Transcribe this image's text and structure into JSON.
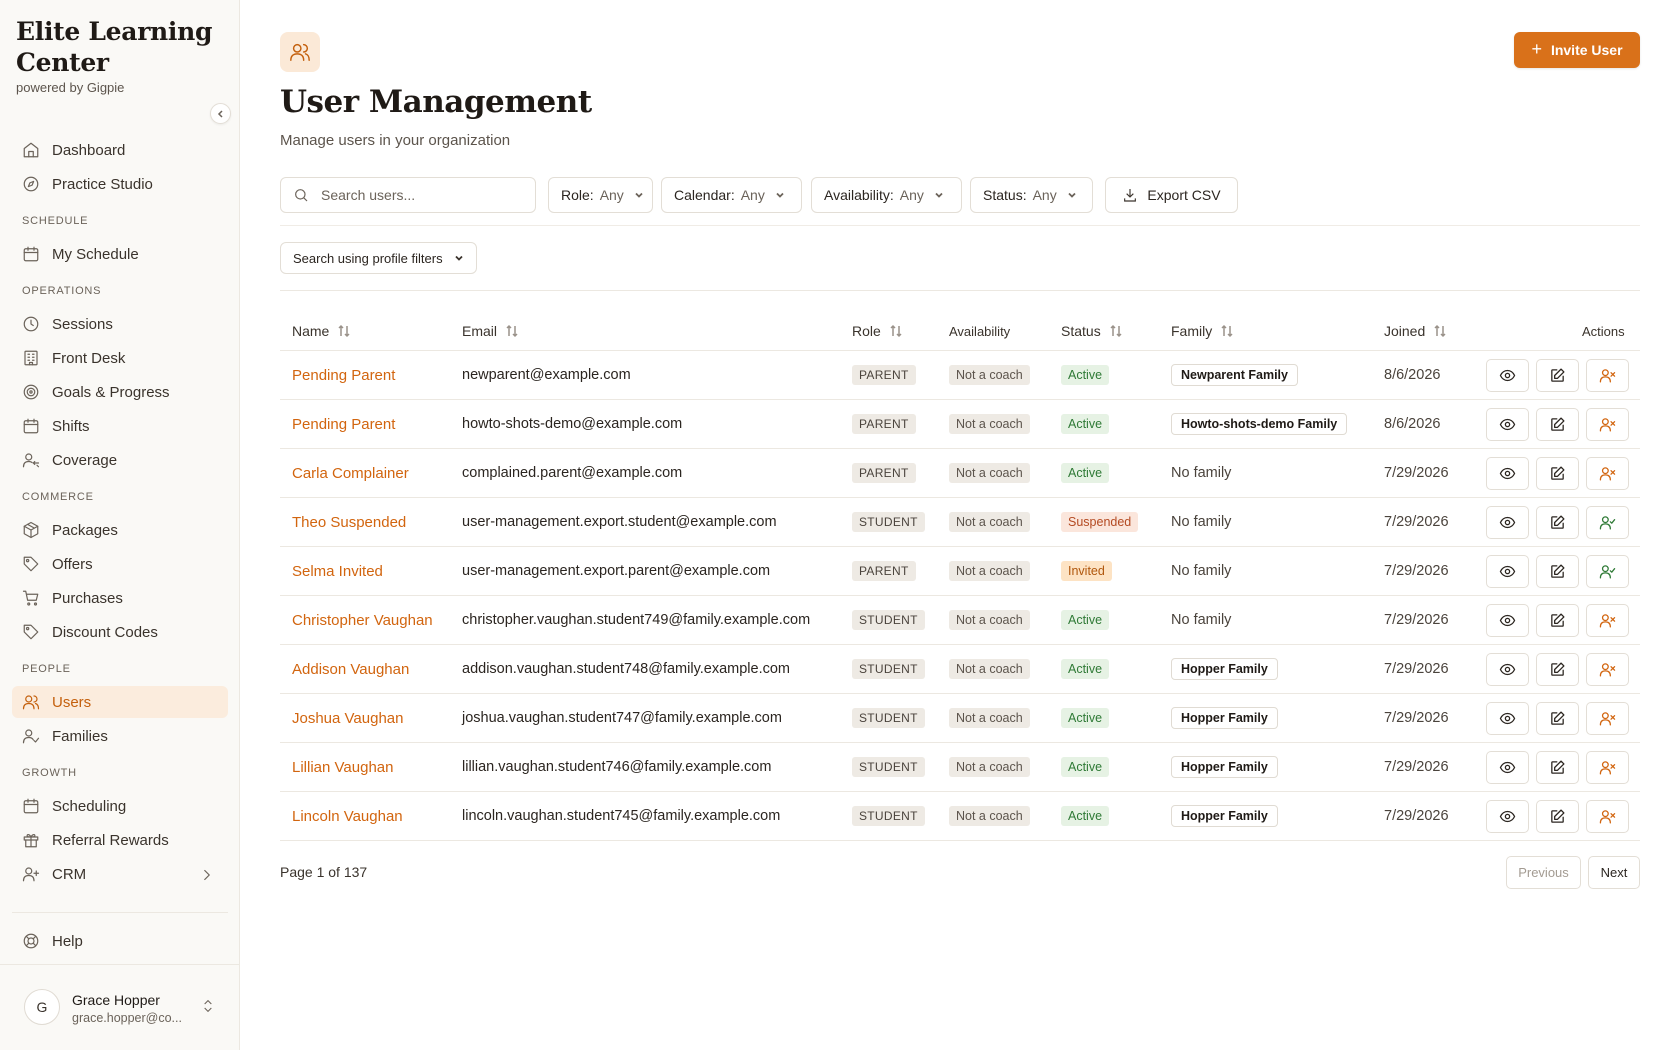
{
  "brand": {
    "title": "Elite Learning Center",
    "subtitle": "powered by Gigpie"
  },
  "sidebar": {
    "top_items": [
      {
        "label": "Dashboard",
        "icon": "home-icon"
      },
      {
        "label": "Practice Studio",
        "icon": "compass-icon"
      }
    ],
    "sections": [
      {
        "title": "SCHEDULE",
        "items": [
          {
            "label": "My Schedule",
            "icon": "calendar-icon"
          }
        ]
      },
      {
        "title": "OPERATIONS",
        "items": [
          {
            "label": "Sessions",
            "icon": "clock-icon"
          },
          {
            "label": "Front Desk",
            "icon": "building-icon"
          },
          {
            "label": "Goals & Progress",
            "icon": "target-icon"
          },
          {
            "label": "Shifts",
            "icon": "calendar-icon"
          },
          {
            "label": "Coverage",
            "icon": "user-swap-icon"
          }
        ]
      },
      {
        "title": "COMMERCE",
        "items": [
          {
            "label": "Packages",
            "icon": "package-icon"
          },
          {
            "label": "Offers",
            "icon": "tag-icon"
          },
          {
            "label": "Purchases",
            "icon": "cart-icon"
          },
          {
            "label": "Discount Codes",
            "icon": "tag-icon"
          }
        ]
      },
      {
        "title": "PEOPLE",
        "items": [
          {
            "label": "Users",
            "icon": "users-icon",
            "active": true
          },
          {
            "label": "Families",
            "icon": "user-check-icon"
          }
        ]
      },
      {
        "title": "GROWTH",
        "items": [
          {
            "label": "Scheduling",
            "icon": "calendar-icon"
          },
          {
            "label": "Referral Rewards",
            "icon": "gift-icon"
          },
          {
            "label": "CRM",
            "icon": "user-plus-icon",
            "has_chevron": true
          }
        ]
      }
    ],
    "help_label": "Help",
    "user": {
      "initial": "G",
      "name": "Grace Hopper",
      "email": "grace.hopper@co..."
    }
  },
  "header": {
    "title": "User Management",
    "subtitle": "Manage users in your organization",
    "invite_label": "Invite User"
  },
  "filters": {
    "search_placeholder": "Search users...",
    "role": {
      "label": "Role:",
      "value": "Any"
    },
    "calendar": {
      "label": "Calendar:",
      "value": "Any"
    },
    "availability": {
      "label": "Availability:",
      "value": "Any"
    },
    "status": {
      "label": "Status:",
      "value": "Any"
    },
    "export_label": "Export CSV",
    "profile_filter_label": "Search using profile filters"
  },
  "table": {
    "columns": {
      "name": "Name",
      "email": "Email",
      "role": "Role",
      "availability": "Availability",
      "status": "Status",
      "family": "Family",
      "joined": "Joined",
      "actions": "Actions"
    },
    "rows": [
      {
        "name": "Pending Parent",
        "email": "newparent@example.com",
        "role": "PARENT",
        "availability": "Not a coach",
        "status": "Active",
        "family": "Newparent Family",
        "joined": "8/6/2026",
        "account_action": "deactivate"
      },
      {
        "name": "Pending Parent",
        "email": "howto-shots-demo@example.com",
        "role": "PARENT",
        "availability": "Not a coach",
        "status": "Active",
        "family": "Howto-shots-demo Family",
        "joined": "8/6/2026",
        "account_action": "deactivate"
      },
      {
        "name": "Carla Complainer",
        "email": "complained.parent@example.com",
        "role": "PARENT",
        "availability": "Not a coach",
        "status": "Active",
        "family": "No family",
        "joined": "7/29/2026",
        "account_action": "deactivate"
      },
      {
        "name": "Theo Suspended",
        "email": "user-management.export.student@example.com",
        "role": "STUDENT",
        "availability": "Not a coach",
        "status": "Suspended",
        "family": "No family",
        "joined": "7/29/2026",
        "account_action": "reactivate"
      },
      {
        "name": "Selma Invited",
        "email": "user-management.export.parent@example.com",
        "role": "PARENT",
        "availability": "Not a coach",
        "status": "Invited",
        "family": "No family",
        "joined": "7/29/2026",
        "account_action": "reactivate"
      },
      {
        "name": "Christopher Vaughan",
        "email": "christopher.vaughan.student749@family.example.com",
        "role": "STUDENT",
        "availability": "Not a coach",
        "status": "Active",
        "family": "No family",
        "joined": "7/29/2026",
        "account_action": "deactivate"
      },
      {
        "name": "Addison Vaughan",
        "email": "addison.vaughan.student748@family.example.com",
        "role": "STUDENT",
        "availability": "Not a coach",
        "status": "Active",
        "family": "Hopper Family",
        "joined": "7/29/2026",
        "account_action": "deactivate"
      },
      {
        "name": "Joshua Vaughan",
        "email": "joshua.vaughan.student747@family.example.com",
        "role": "STUDENT",
        "availability": "Not a coach",
        "status": "Active",
        "family": "Hopper Family",
        "joined": "7/29/2026",
        "account_action": "deactivate"
      },
      {
        "name": "Lillian Vaughan",
        "email": "lillian.vaughan.student746@family.example.com",
        "role": "STUDENT",
        "availability": "Not a coach",
        "status": "Active",
        "family": "Hopper Family",
        "joined": "7/29/2026",
        "account_action": "deactivate"
      },
      {
        "name": "Lincoln Vaughan",
        "email": "lincoln.vaughan.student745@family.example.com",
        "role": "STUDENT",
        "availability": "Not a coach",
        "status": "Active",
        "family": "Hopper Family",
        "joined": "7/29/2026",
        "account_action": "deactivate"
      }
    ]
  },
  "pagination": {
    "text": "Page 1 of 137",
    "previous_label": "Previous",
    "next_label": "Next"
  },
  "colors": {
    "accent": "#d9711a",
    "link": "#d2650f",
    "active_bg": "#e6f2e4",
    "suspended_bg": "#fbe6dc",
    "invited_bg": "#fde3c4"
  }
}
